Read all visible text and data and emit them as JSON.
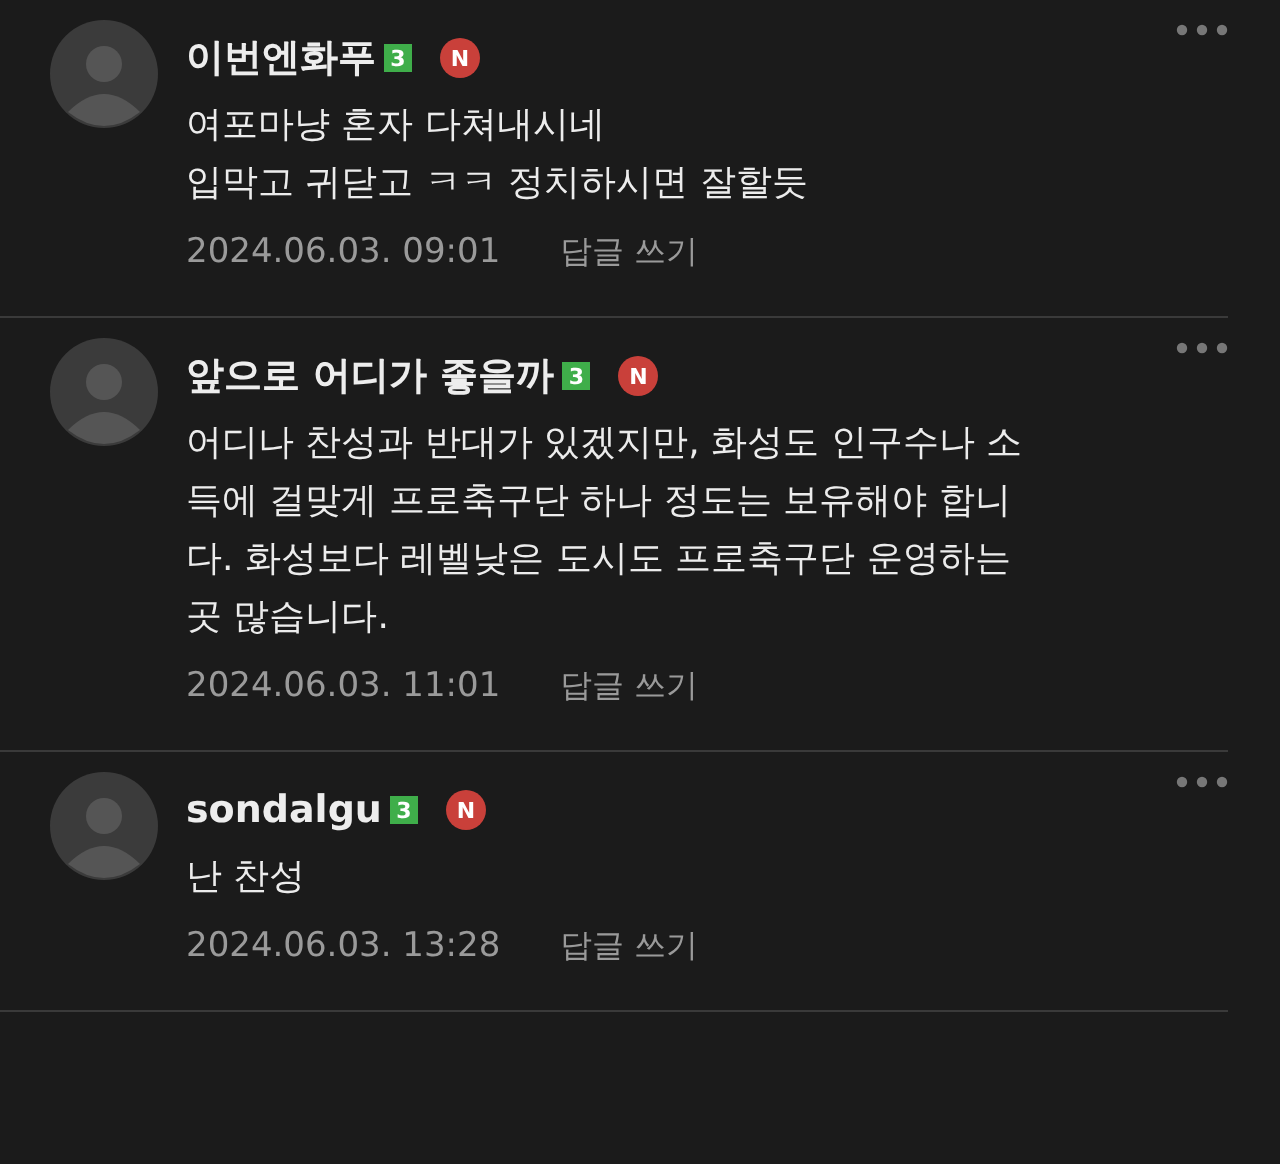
{
  "comments": [
    {
      "author": "이번엔화푸",
      "level_badge": "3",
      "new_badge": "N",
      "body_lines": [
        "여포마냥 혼자 다쳐내시네",
        "입막고 귀닫고 ㅋㅋ 정치하시면 잘할듯"
      ],
      "date": "2024.06.03. 09:01",
      "reply": "답글 쓰기"
    },
    {
      "author": "앞으로 어디가 좋을까",
      "level_badge": "3",
      "new_badge": "N",
      "body_lines": [
        "어디나 찬성과 반대가 있겠지만, 화성도 인구수나 소",
        "득에 걸맞게 프로축구단 하나 정도는 보유해야 합니",
        "다. 화성보다 레벨낮은 도시도 프로축구단 운영하는",
        "곳 많습니다."
      ],
      "date": "2024.06.03. 11:01",
      "reply": "답글 쓰기"
    },
    {
      "author": "sondalgu",
      "level_badge": "3",
      "new_badge": "N",
      "body_lines": [
        "난 찬성"
      ],
      "date": "2024.06.03. 13:28",
      "reply": "답글 쓰기"
    }
  ]
}
